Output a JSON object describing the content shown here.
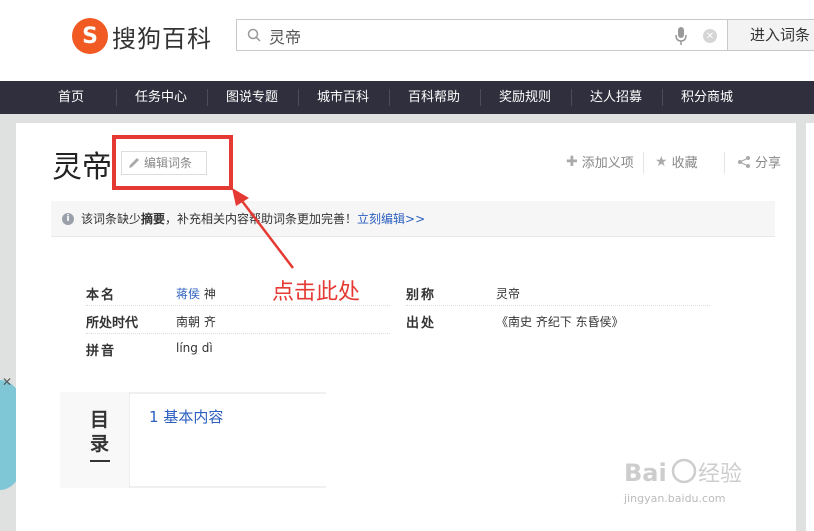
{
  "header": {
    "logo_mark": "S",
    "logo_text": "搜狗百科",
    "search_value": "灵帝",
    "enter_button": "进入词条"
  },
  "nav": {
    "items": [
      "首页",
      "任务中心",
      "图说专题",
      "城市百科",
      "百科帮助",
      "奖励规则",
      "达人招募",
      "积分商城"
    ]
  },
  "entry": {
    "title": "灵帝",
    "edit_button": "编辑词条",
    "actions": {
      "add_meaning": "添加义项",
      "favorite": "收藏",
      "share": "分享"
    }
  },
  "notice": {
    "prefix": "该词条缺少",
    "bold": "摘要",
    "suffix": "，补充相关内容帮助词条更加完善！",
    "link": "立刻编辑>>"
  },
  "annotation": {
    "click_here": "点击此处",
    "color": "#e53a33"
  },
  "infobox": {
    "left": [
      {
        "label": "本名",
        "value_link": "蒋侯",
        "value_rest": "神"
      },
      {
        "label": "所处时代",
        "value_link": "",
        "value_rest": "南朝 齐"
      },
      {
        "label": "拼音",
        "value_link": "",
        "value_rest": "líng dì"
      }
    ],
    "right": [
      {
        "label": "别称",
        "value": "灵帝"
      },
      {
        "label": "出处",
        "value": "《南史 齐纪下 东昏侯》"
      }
    ]
  },
  "toc": {
    "label": "目录",
    "items": [
      {
        "num": "1",
        "text": "基本内容"
      }
    ]
  },
  "watermark": {
    "text": "jingyan.baidu.com"
  },
  "colors": {
    "nav_bg": "#2f2f3d",
    "link": "#2b5fbf",
    "logo": "#f15a22"
  }
}
